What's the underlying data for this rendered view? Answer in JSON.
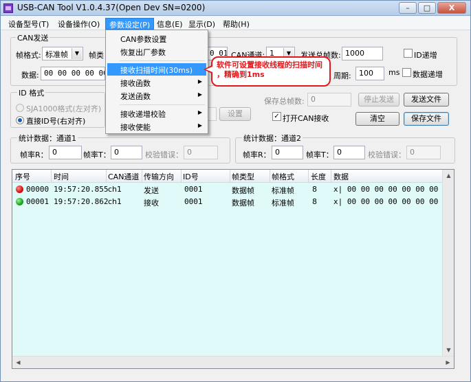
{
  "window": {
    "title": "USB-CAN Tool V1.0.4.37(Open Dev SN=0200)",
    "buttons": {
      "minimize": "–",
      "maximize": "□",
      "close": "X"
    }
  },
  "menubar": {
    "items": [
      {
        "label": "设备型号(T)"
      },
      {
        "label": "设备操作(O)"
      },
      {
        "label": "参数设定(P)"
      },
      {
        "label": "信息(E)"
      },
      {
        "label": "显示(D)"
      },
      {
        "label": "帮助(H)"
      }
    ]
  },
  "dropdown": {
    "items": [
      {
        "label": "CAN参数设置"
      },
      {
        "label": "恢复出厂参数"
      },
      {
        "label": "接收扫描时间(30ms)"
      },
      {
        "label": "接收函数"
      },
      {
        "label": "发送函数"
      },
      {
        "label": "接收递增校验"
      },
      {
        "label": "接收使能"
      }
    ]
  },
  "callout": {
    "line1": "软件可设置接收线程的扫描时间",
    "line2": "，精确到1ms"
  },
  "can_send": {
    "group_label": "CAN发送",
    "frame_format_label": "帧格式:",
    "frame_format_value": "标准帧",
    "frame_type_label": "帧类",
    "id_partial": "0 01",
    "channel_label": "CAN通道:",
    "channel_value": "1",
    "total_send_label": "发送总帧数:",
    "total_send_value": "1000",
    "id_increment_label": "ID递增",
    "data_label": "数据:",
    "data_value": "00 00 00 00 00 00",
    "period_label": "周期:",
    "period_value": "100",
    "period_unit": "ms",
    "data_increment_label": "数据递增"
  },
  "id_format": {
    "group_label": "ID 格式",
    "option1": "SJA1000格式(左对齐)",
    "option2": "直接ID号(右对齐)"
  },
  "mid": {
    "set_button": "设置",
    "save_total_label": "保存总帧数:",
    "save_total_value": "0",
    "stop_send_button": "停止发送",
    "send_file_button": "发送文件",
    "open_can_recv_label": "打开CAN接收",
    "open_can_recv_checked": "✓",
    "clear_button": "清空",
    "save_file_button": "保存文件"
  },
  "stats1": {
    "group_label": "统计数据：通道1",
    "frame_rate_r_label": "帧率R：",
    "frame_rate_r_value": "0",
    "frame_rate_t_label": "帧率T：",
    "frame_rate_t_value": "0",
    "check_error_label": "校验错误：",
    "check_error_value": "0"
  },
  "stats2": {
    "group_label": "统计数据：通道2",
    "frame_rate_r_label": "帧率R：",
    "frame_rate_r_value": "0",
    "frame_rate_t_label": "帧率T：",
    "frame_rate_t_value": "0",
    "check_error_label": "校验错误：",
    "check_error_value": "0"
  },
  "table": {
    "columns": [
      "序号",
      "时间",
      "CAN通道",
      "传输方向",
      "ID号",
      "帧类型",
      "帧格式",
      "长度",
      "数据"
    ],
    "rows": [
      {
        "status_color": "#d41010",
        "seq": "00000",
        "time": "19:57:20.855",
        "channel": "ch1",
        "direction": "发送",
        "id": "0001",
        "frame_type": "数据帧",
        "frame_format": "标准帧",
        "length": "8",
        "data": "x| 00 00 00 00 00 00 00 00"
      },
      {
        "status_color": "#1aa51a",
        "seq": "00001",
        "time": "19:57:20.862",
        "channel": "ch1",
        "direction": "接收",
        "id": "0001",
        "frame_type": "数据帧",
        "frame_format": "标准帧",
        "length": "8",
        "data": "x| 00 00 00 00 00 00 00 00"
      }
    ]
  },
  "colors": {
    "menu_highlight": "#3399ff",
    "callout": "#e0181c",
    "grid_background": "#e0fafa"
  }
}
